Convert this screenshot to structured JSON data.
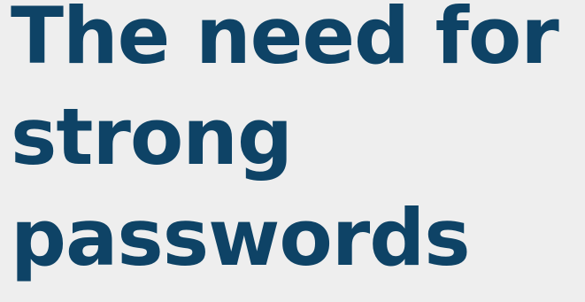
{
  "headline": {
    "line1": "The need for",
    "line2": "strong",
    "line3": "passwords",
    "color": "#0e4366"
  },
  "background": {
    "color": "#eeeeee"
  }
}
